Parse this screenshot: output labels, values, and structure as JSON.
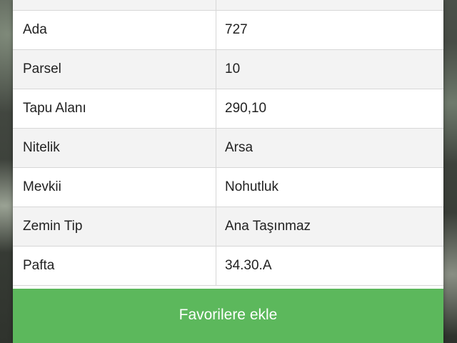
{
  "parcel_table": {
    "rows": [
      {
        "label": "",
        "value": ""
      },
      {
        "label": "Ada",
        "value": "727"
      },
      {
        "label": "Parsel",
        "value": "10"
      },
      {
        "label": "Tapu Alanı",
        "value": "290,10"
      },
      {
        "label": "Nitelik",
        "value": "Arsa"
      },
      {
        "label": "Mevkii",
        "value": "Nohutluk"
      },
      {
        "label": "Zemin Tip",
        "value": "Ana Taşınmaz"
      },
      {
        "label": "Pafta",
        "value": "34.30.A"
      }
    ]
  },
  "actions": {
    "favorite_label": "Favorilere ekle"
  },
  "colors": {
    "button_green": "#5cb85c",
    "row_alt": "#f3f3f3",
    "border": "#d7d7d7"
  }
}
